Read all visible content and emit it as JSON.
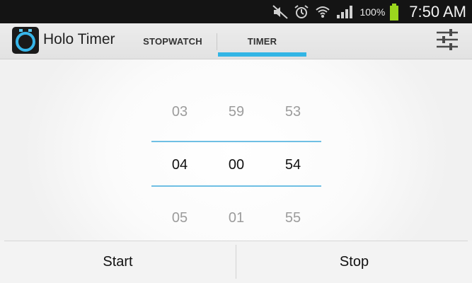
{
  "status_bar": {
    "icons": [
      "mute-icon",
      "alarm-icon",
      "wifi-icon",
      "signal-icon",
      "battery-charging-icon"
    ],
    "battery_percent": "100%",
    "time": "7:50 AM",
    "battery_color": "#9bd61e"
  },
  "action_bar": {
    "app_title": "Holo Timer",
    "app_icon": "stopwatch-icon",
    "tabs": [
      {
        "label": "STOPWATCH",
        "selected": false
      },
      {
        "label": "TIMER",
        "selected": true
      }
    ],
    "settings_icon": "sliders-icon",
    "accent_color": "#33b5e5"
  },
  "picker": {
    "hours": {
      "prev": "03",
      "current": "04",
      "next": "05"
    },
    "minutes": {
      "prev": "59",
      "current": "00",
      "next": "01"
    },
    "seconds": {
      "prev": "53",
      "current": "54",
      "next": "55"
    }
  },
  "buttons": {
    "start": "Start",
    "stop": "Stop"
  }
}
